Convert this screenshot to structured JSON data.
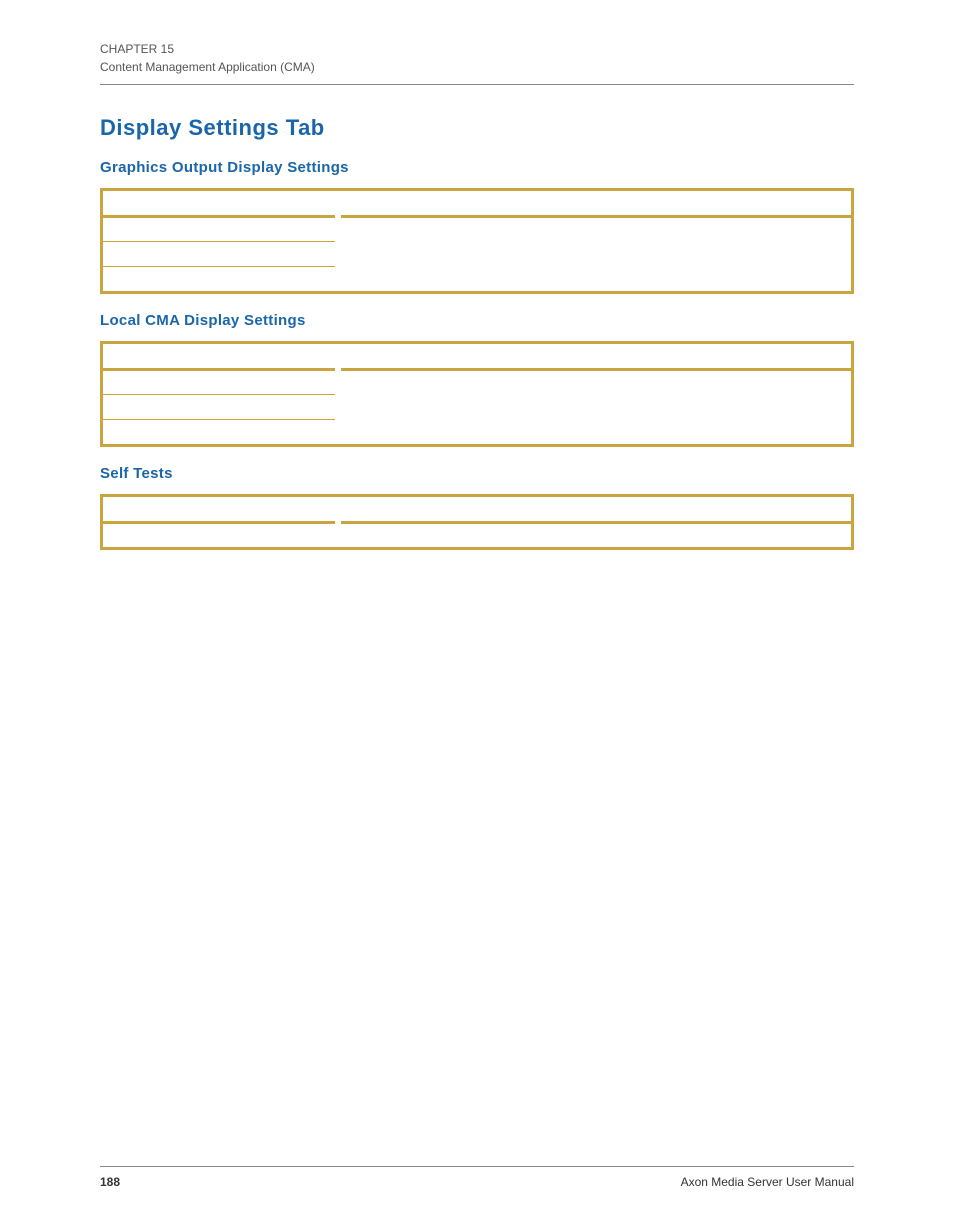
{
  "header": {
    "chapter": "CHAPTER 15",
    "section": "Content Management Application (CMA)"
  },
  "main_heading": "Display Settings Tab",
  "sections": [
    {
      "title": "Graphics Output Display Settings",
      "rows": 3
    },
    {
      "title": "Local CMA Display Settings",
      "rows": 3
    },
    {
      "title": "Self Tests",
      "rows": 1
    }
  ],
  "footer": {
    "page": "188",
    "manual": "Axon Media Server User Manual"
  }
}
